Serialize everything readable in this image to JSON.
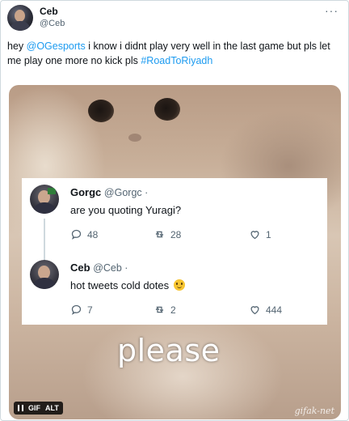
{
  "tweet": {
    "author_name": "Ceb",
    "author_handle": "@Ceb",
    "more_label": "···",
    "text_parts": {
      "part1": "hey ",
      "mention": "@OGesports",
      "part2": " i know i didnt play very well in the last game but pls let me play one more no kick pls ",
      "hashtag": "#RoadToRiyadh"
    }
  },
  "media": {
    "caption": "please",
    "watermark": "gifak-net",
    "badges": {
      "gif": "GIF",
      "alt": "ALT"
    }
  },
  "quoted_thread": [
    {
      "name": "Gorgc",
      "handle_time": "@Gorgc ·",
      "text": "are you quoting Yuragi?",
      "replies": "48",
      "retweets": "28",
      "likes": "1"
    },
    {
      "name": "Ceb",
      "handle_time": "@Ceb ·",
      "text": "hot tweets cold dotes",
      "emoji": "slightly-smiling-face",
      "replies": "7",
      "retweets": "2",
      "likes": "444"
    }
  ],
  "colors": {
    "link": "#1d9bf0",
    "secondary_text": "#536471",
    "primary_text": "#0f1419"
  }
}
